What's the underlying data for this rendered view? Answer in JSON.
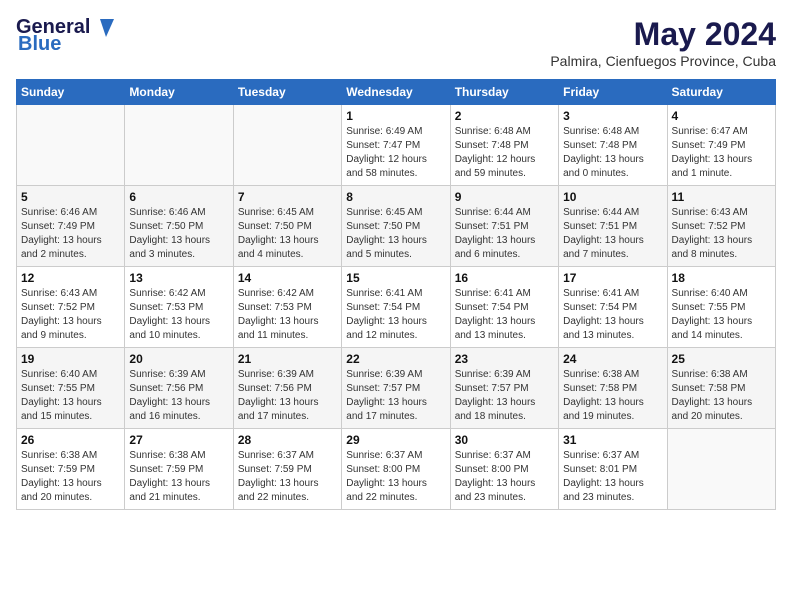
{
  "logo": {
    "general": "General",
    "blue": "Blue"
  },
  "header": {
    "title": "May 2024",
    "subtitle": "Palmira, Cienfuegos Province, Cuba"
  },
  "days_of_week": [
    "Sunday",
    "Monday",
    "Tuesday",
    "Wednesday",
    "Thursday",
    "Friday",
    "Saturday"
  ],
  "weeks": [
    [
      {
        "day": "",
        "info": ""
      },
      {
        "day": "",
        "info": ""
      },
      {
        "day": "",
        "info": ""
      },
      {
        "day": "1",
        "info": "Sunrise: 6:49 AM\nSunset: 7:47 PM\nDaylight: 12 hours and 58 minutes."
      },
      {
        "day": "2",
        "info": "Sunrise: 6:48 AM\nSunset: 7:48 PM\nDaylight: 12 hours and 59 minutes."
      },
      {
        "day": "3",
        "info": "Sunrise: 6:48 AM\nSunset: 7:48 PM\nDaylight: 13 hours and 0 minutes."
      },
      {
        "day": "4",
        "info": "Sunrise: 6:47 AM\nSunset: 7:49 PM\nDaylight: 13 hours and 1 minute."
      }
    ],
    [
      {
        "day": "5",
        "info": "Sunrise: 6:46 AM\nSunset: 7:49 PM\nDaylight: 13 hours and 2 minutes."
      },
      {
        "day": "6",
        "info": "Sunrise: 6:46 AM\nSunset: 7:50 PM\nDaylight: 13 hours and 3 minutes."
      },
      {
        "day": "7",
        "info": "Sunrise: 6:45 AM\nSunset: 7:50 PM\nDaylight: 13 hours and 4 minutes."
      },
      {
        "day": "8",
        "info": "Sunrise: 6:45 AM\nSunset: 7:50 PM\nDaylight: 13 hours and 5 minutes."
      },
      {
        "day": "9",
        "info": "Sunrise: 6:44 AM\nSunset: 7:51 PM\nDaylight: 13 hours and 6 minutes."
      },
      {
        "day": "10",
        "info": "Sunrise: 6:44 AM\nSunset: 7:51 PM\nDaylight: 13 hours and 7 minutes."
      },
      {
        "day": "11",
        "info": "Sunrise: 6:43 AM\nSunset: 7:52 PM\nDaylight: 13 hours and 8 minutes."
      }
    ],
    [
      {
        "day": "12",
        "info": "Sunrise: 6:43 AM\nSunset: 7:52 PM\nDaylight: 13 hours and 9 minutes."
      },
      {
        "day": "13",
        "info": "Sunrise: 6:42 AM\nSunset: 7:53 PM\nDaylight: 13 hours and 10 minutes."
      },
      {
        "day": "14",
        "info": "Sunrise: 6:42 AM\nSunset: 7:53 PM\nDaylight: 13 hours and 11 minutes."
      },
      {
        "day": "15",
        "info": "Sunrise: 6:41 AM\nSunset: 7:54 PM\nDaylight: 13 hours and 12 minutes."
      },
      {
        "day": "16",
        "info": "Sunrise: 6:41 AM\nSunset: 7:54 PM\nDaylight: 13 hours and 13 minutes."
      },
      {
        "day": "17",
        "info": "Sunrise: 6:41 AM\nSunset: 7:54 PM\nDaylight: 13 hours and 13 minutes."
      },
      {
        "day": "18",
        "info": "Sunrise: 6:40 AM\nSunset: 7:55 PM\nDaylight: 13 hours and 14 minutes."
      }
    ],
    [
      {
        "day": "19",
        "info": "Sunrise: 6:40 AM\nSunset: 7:55 PM\nDaylight: 13 hours and 15 minutes."
      },
      {
        "day": "20",
        "info": "Sunrise: 6:39 AM\nSunset: 7:56 PM\nDaylight: 13 hours and 16 minutes."
      },
      {
        "day": "21",
        "info": "Sunrise: 6:39 AM\nSunset: 7:56 PM\nDaylight: 13 hours and 17 minutes."
      },
      {
        "day": "22",
        "info": "Sunrise: 6:39 AM\nSunset: 7:57 PM\nDaylight: 13 hours and 17 minutes."
      },
      {
        "day": "23",
        "info": "Sunrise: 6:39 AM\nSunset: 7:57 PM\nDaylight: 13 hours and 18 minutes."
      },
      {
        "day": "24",
        "info": "Sunrise: 6:38 AM\nSunset: 7:58 PM\nDaylight: 13 hours and 19 minutes."
      },
      {
        "day": "25",
        "info": "Sunrise: 6:38 AM\nSunset: 7:58 PM\nDaylight: 13 hours and 20 minutes."
      }
    ],
    [
      {
        "day": "26",
        "info": "Sunrise: 6:38 AM\nSunset: 7:59 PM\nDaylight: 13 hours and 20 minutes."
      },
      {
        "day": "27",
        "info": "Sunrise: 6:38 AM\nSunset: 7:59 PM\nDaylight: 13 hours and 21 minutes."
      },
      {
        "day": "28",
        "info": "Sunrise: 6:37 AM\nSunset: 7:59 PM\nDaylight: 13 hours and 22 minutes."
      },
      {
        "day": "29",
        "info": "Sunrise: 6:37 AM\nSunset: 8:00 PM\nDaylight: 13 hours and 22 minutes."
      },
      {
        "day": "30",
        "info": "Sunrise: 6:37 AM\nSunset: 8:00 PM\nDaylight: 13 hours and 23 minutes."
      },
      {
        "day": "31",
        "info": "Sunrise: 6:37 AM\nSunset: 8:01 PM\nDaylight: 13 hours and 23 minutes."
      },
      {
        "day": "",
        "info": ""
      }
    ]
  ]
}
